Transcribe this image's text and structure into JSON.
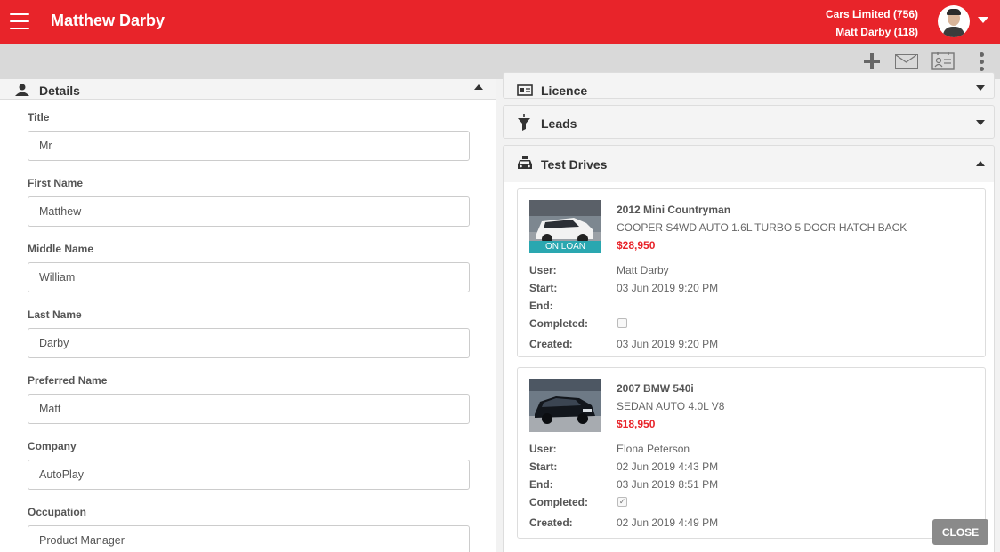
{
  "header": {
    "title": "Matthew Darby",
    "account_line1": "Cars Limited (756)",
    "account_line2": "Matt Darby (118)"
  },
  "details": {
    "title": "Details",
    "fields": [
      {
        "label": "Title",
        "value": "Mr"
      },
      {
        "label": "First Name",
        "value": "Matthew"
      },
      {
        "label": "Middle Name",
        "value": "William"
      },
      {
        "label": "Last Name",
        "value": "Darby"
      },
      {
        "label": "Preferred Name",
        "value": "Matt"
      },
      {
        "label": "Company",
        "value": "AutoPlay"
      },
      {
        "label": "Occupation",
        "value": "Product Manager"
      }
    ]
  },
  "sections": {
    "licence": "Licence",
    "leads": "Leads",
    "test_drives": "Test Drives"
  },
  "test_drive_labels": {
    "user": "User:",
    "start": "Start:",
    "end": "End:",
    "completed": "Completed:",
    "created": "Created:"
  },
  "test_drives": [
    {
      "title": "2012 Mini Countryman",
      "desc": "COOPER S4WD AUTO 1.6L TURBO 5 DOOR HATCH BACK",
      "price": "$28,950",
      "badge": "ON LOAN",
      "user": "Matt Darby",
      "start": "03 Jun 2019 9:20 PM",
      "end": "",
      "completed": false,
      "created": "03 Jun 2019 9:20 PM"
    },
    {
      "title": "2007 BMW 540i",
      "desc": "SEDAN AUTO 4.0L V8",
      "price": "$18,950",
      "user": "Elona Peterson",
      "start": "02 Jun 2019 4:43 PM",
      "end": "03 Jun 2019 8:51 PM",
      "completed": true,
      "created": "02 Jun 2019 4:49 PM"
    }
  ],
  "close_label": "CLOSE",
  "colors": {
    "brand": "#e8242a",
    "badge": "#2aa7b0"
  }
}
